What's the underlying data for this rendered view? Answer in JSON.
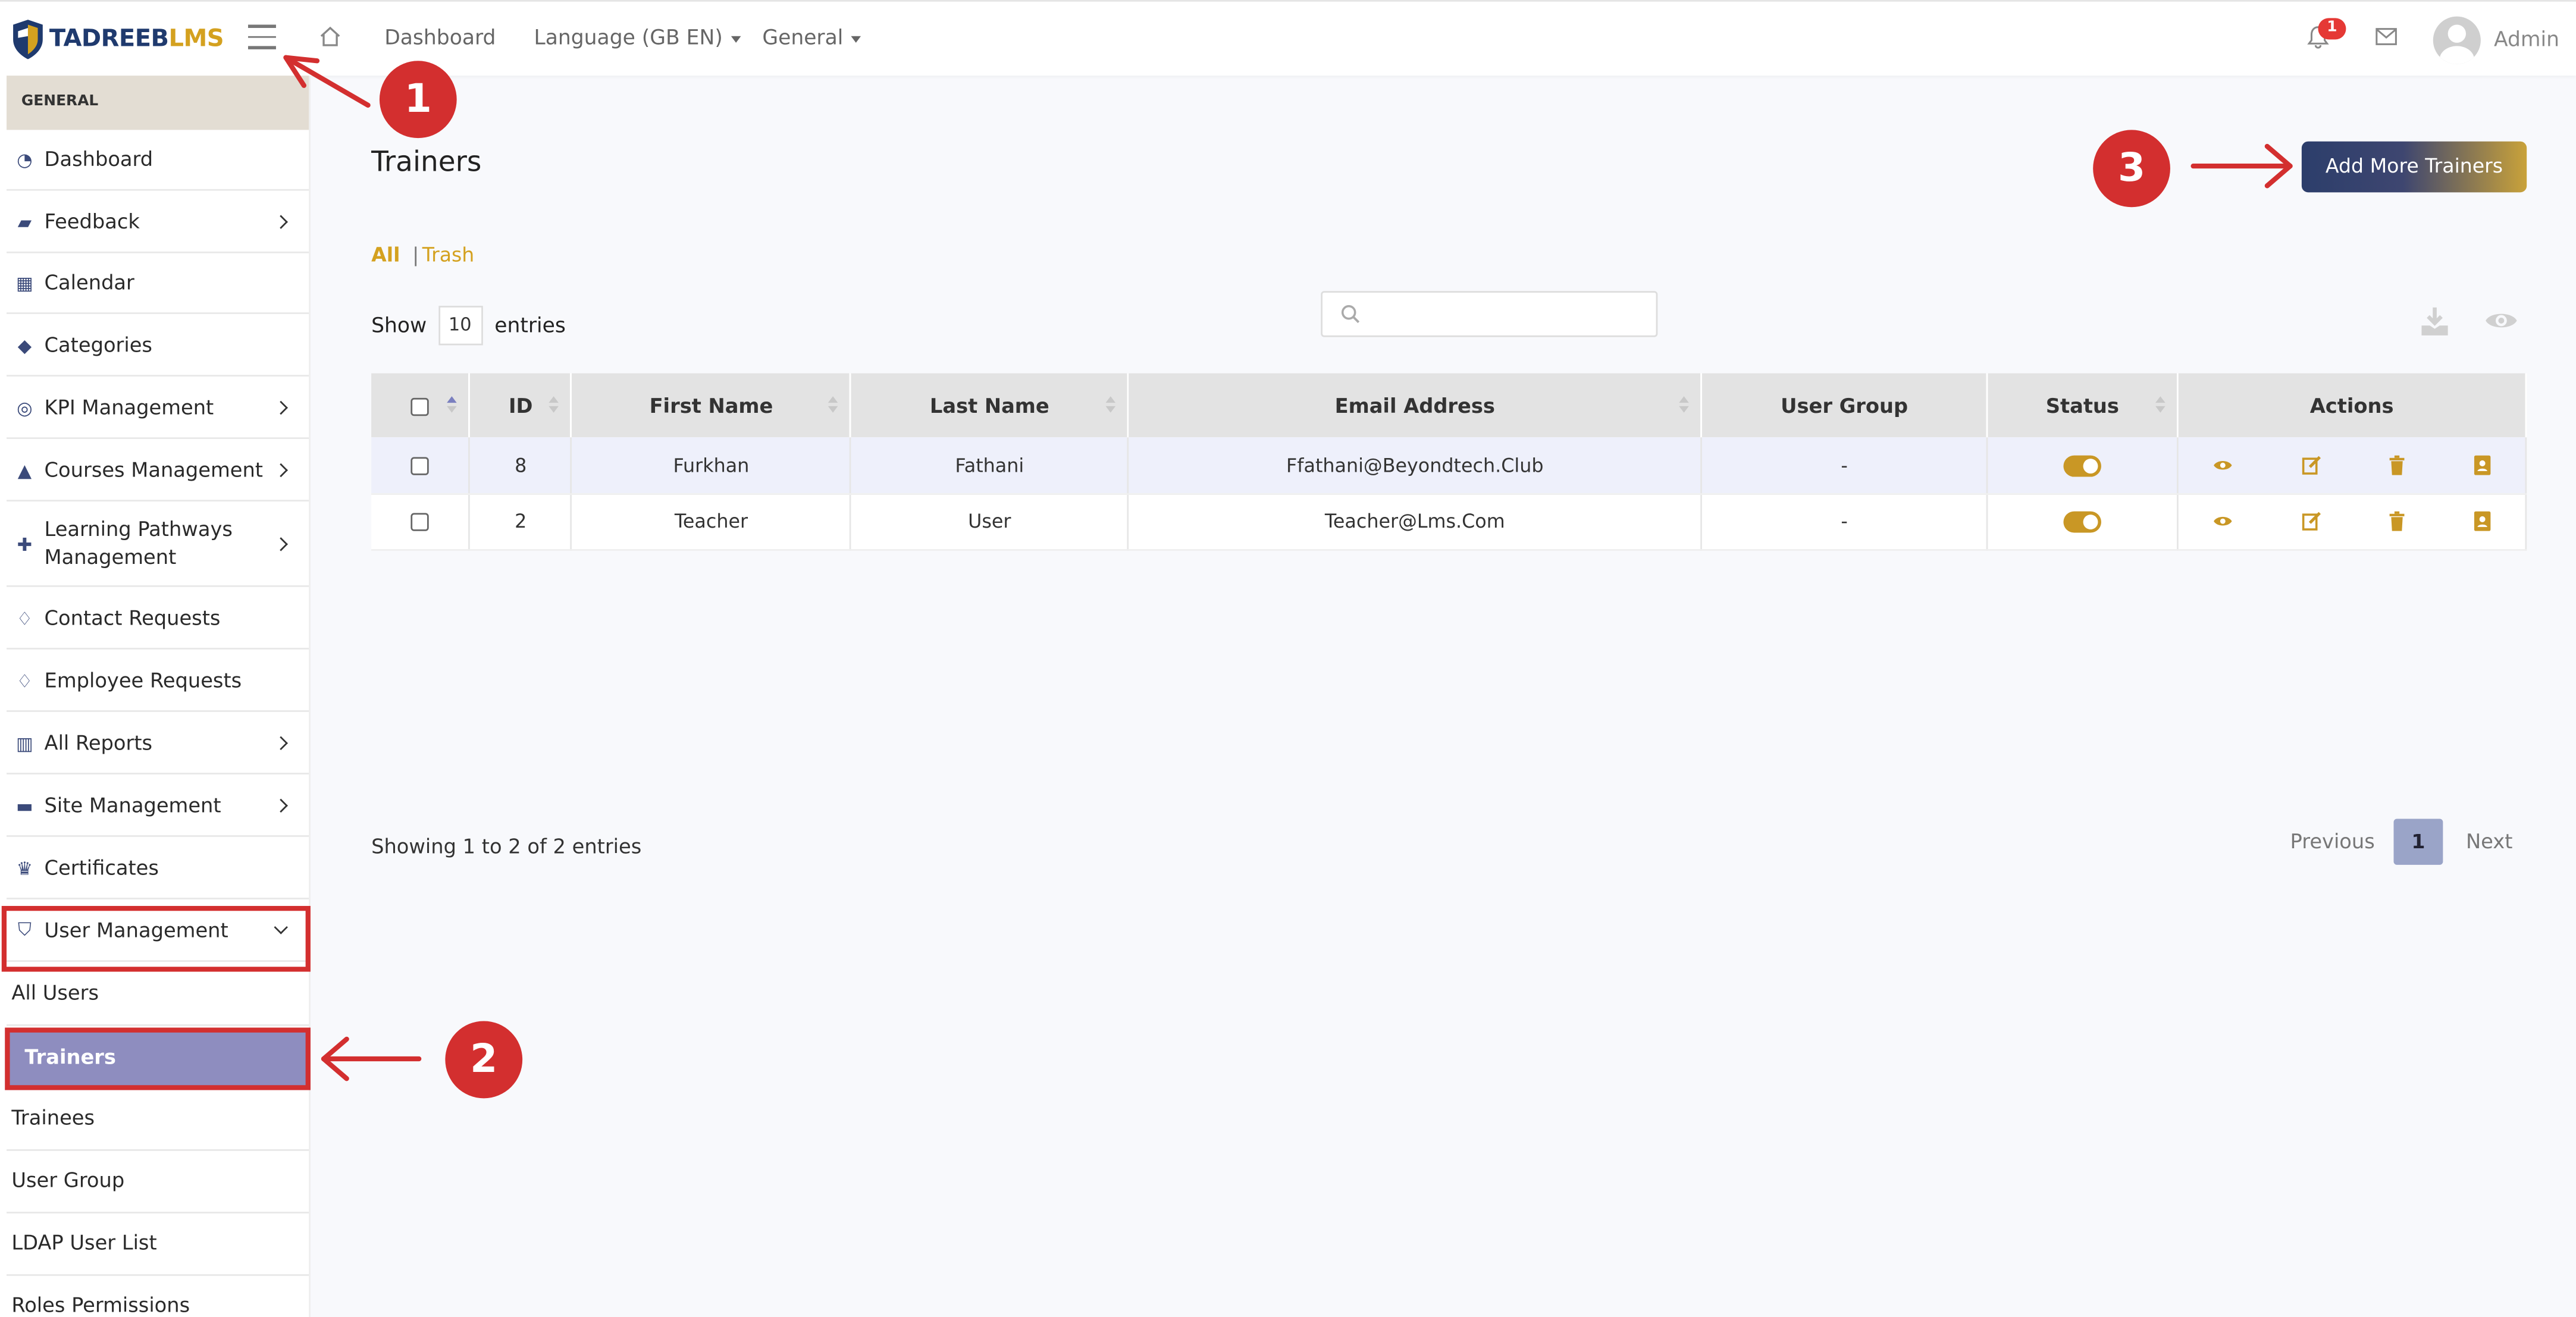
{
  "brand": {
    "name_part1": "TADREEB",
    "name_part2": "LMS"
  },
  "topnav": {
    "dashboard": "Dashboard",
    "language": "Language (GB EN)",
    "general": "General",
    "notifications_count": "1",
    "user": "Admin"
  },
  "sidebar": {
    "section": "GENERAL",
    "items": [
      {
        "label": "Dashboard",
        "icon": "gauge-icon"
      },
      {
        "label": "Feedback",
        "icon": "comments-icon"
      },
      {
        "label": "Calendar",
        "icon": "calendar-icon"
      },
      {
        "label": "Categories",
        "icon": "tags-icon"
      },
      {
        "label": "KPI Management",
        "icon": "target-icon"
      },
      {
        "label": "Courses Management",
        "icon": "graduation-cap-icon"
      },
      {
        "label": "Learning Pathways Management",
        "icon": "puzzle-icon"
      },
      {
        "label": "Contact Requests",
        "icon": "handshake-icon"
      },
      {
        "label": "Employee Requests",
        "icon": "handshake-icon"
      },
      {
        "label": "All Reports",
        "icon": "bar-chart-icon"
      },
      {
        "label": "Site Management",
        "icon": "folder-icon"
      },
      {
        "label": "Certificates",
        "icon": "trophy-icon"
      },
      {
        "label": "User Management",
        "icon": "shield-icon"
      }
    ],
    "sub_items": [
      "All Users",
      "Trainers",
      "Trainees",
      "User Group",
      "LDAP User List",
      "Roles Permissions"
    ]
  },
  "page": {
    "title": "Trainers",
    "add_button": "Add More Trainers",
    "filter_all": "All",
    "filter_sep": "|",
    "filter_trash": "Trash",
    "show_label": "Show",
    "show_value": "10",
    "entries_label": "entries"
  },
  "table": {
    "headers": [
      "ID",
      "First Name",
      "Last Name",
      "Email Address",
      "User Group",
      "Status",
      "Actions"
    ],
    "rows": [
      {
        "id": "8",
        "first": "Furkhan",
        "last": "Fathani",
        "email": "Ffathani@Beyondtech.Club",
        "group": "-",
        "status": "on"
      },
      {
        "id": "2",
        "first": "Teacher",
        "last": "User",
        "email": "Teacher@Lms.Com",
        "group": "-",
        "status": "on"
      }
    ]
  },
  "pagination": {
    "info": "Showing 1 to 2 of 2 entries",
    "previous": "Previous",
    "current": "1",
    "next": "Next"
  },
  "callouts": [
    "1",
    "2",
    "3"
  ],
  "colors": {
    "accent_gold": "#d4a11f",
    "navy": "#2c3e6b",
    "callout_red": "#d32f2f",
    "active_purple": "#8e8dbf"
  }
}
